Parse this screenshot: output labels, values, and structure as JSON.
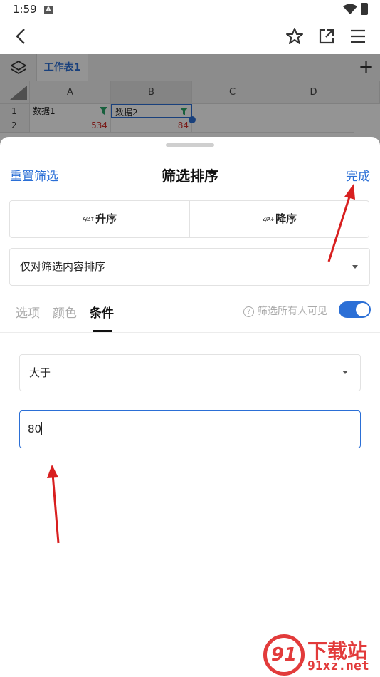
{
  "status": {
    "time": "1:59",
    "notif_letter": "A"
  },
  "sheet": {
    "tab_name": "工作表1",
    "columns": [
      "A",
      "B",
      "C",
      "D"
    ],
    "rows": [
      {
        "num": "1",
        "a": "数据1",
        "b": "数据2"
      },
      {
        "num": "2",
        "a": "534",
        "b": "84"
      }
    ]
  },
  "panel": {
    "reset_label": "重置筛选",
    "title": "筛选排序",
    "done_label": "完成",
    "sort_asc_label": "升序",
    "sort_asc_icon": "A/Z↑",
    "sort_desc_label": "降序",
    "sort_desc_icon": "Z/A↓",
    "sort_scope": "仅对筛选内容排序",
    "tabs": [
      "选项",
      "颜色",
      "条件"
    ],
    "active_tab": "条件",
    "visibility_label": "筛选所有人可见",
    "visibility_on": true,
    "condition": "大于",
    "condition_value": "80"
  },
  "watermark": {
    "text": "下载站",
    "url": "91xz.net",
    "logo": "91"
  },
  "colors": {
    "accent": "#2b6fd6",
    "negative": "#d0312d",
    "watermark": "#e23b3b"
  }
}
